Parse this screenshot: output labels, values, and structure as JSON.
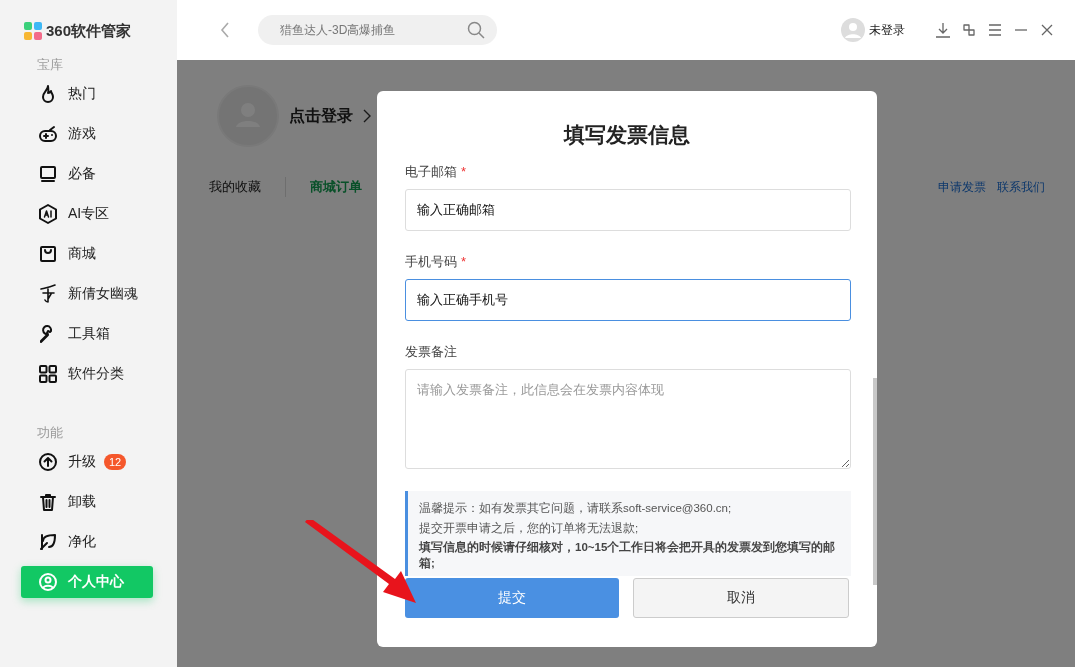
{
  "app": {
    "title": "360软件管家"
  },
  "sidebar": {
    "sections": [
      {
        "heading": "宝库",
        "items": [
          {
            "label": "热门",
            "selected": false
          },
          {
            "label": "游戏",
            "selected": false
          },
          {
            "label": "必备",
            "selected": false
          },
          {
            "label": "AI专区",
            "selected": false
          },
          {
            "label": "商城",
            "selected": false
          },
          {
            "label": "新倩女幽魂",
            "selected": false
          },
          {
            "label": "工具箱",
            "selected": false
          },
          {
            "label": "软件分类",
            "selected": false
          }
        ]
      },
      {
        "heading": "功能",
        "items": [
          {
            "label": "升级",
            "badge": "12",
            "selected": false
          },
          {
            "label": "卸载",
            "selected": false
          },
          {
            "label": "净化",
            "selected": false
          },
          {
            "label": "个人中心",
            "selected": true
          }
        ]
      }
    ]
  },
  "topbar": {
    "search": {
      "placeholder": "猎鱼达人-3D高爆捕鱼"
    },
    "user": "未登录"
  },
  "profile": {
    "login": "点击登录"
  },
  "tabs": [
    {
      "label": "我的收藏",
      "selected": false
    },
    {
      "label": "商城订单",
      "selected": true
    }
  ],
  "links": [
    "申请发票",
    "联系我们"
  ],
  "dialog": {
    "title": "填写发票信息",
    "fields": [
      {
        "kind": "input",
        "label": "电子邮箱",
        "required_mark": "*",
        "value": "输入正确邮箱",
        "focused": false
      },
      {
        "kind": "input",
        "label": "手机号码",
        "required_mark": "*",
        "value": "输入正确手机号",
        "focused": true
      },
      {
        "kind": "textarea",
        "label": "发票备注",
        "placeholder": "请输入发票备注，此信息会在发票内容体现"
      }
    ],
    "notice": [
      {
        "text": "温馨提示：如有发票其它问题，请联系soft-service@360.cn;",
        "bold": false
      },
      {
        "text": "提交开票申请之后，您的订单将无法退款;",
        "bold": false
      },
      {
        "text": "填写信息的时候请仔细核对，10~15个工作日将会把开具的发票发到您填写的邮箱;",
        "bold": true
      }
    ],
    "buttons": [
      {
        "label": "提交",
        "kind": "primary"
      },
      {
        "label": "取消",
        "kind": "secondary"
      }
    ]
  }
}
